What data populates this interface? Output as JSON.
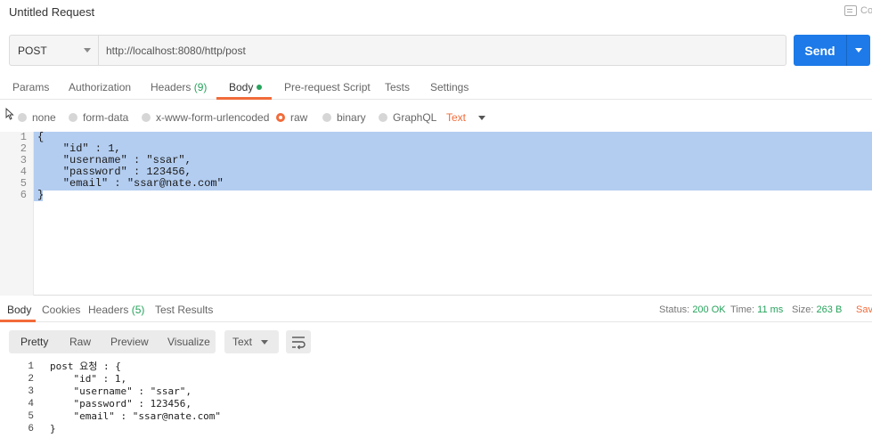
{
  "header": {
    "title": "Untitled Request",
    "comments_label": "Comments"
  },
  "request": {
    "method": "POST",
    "url": "http://localhost:8080/http/post",
    "send_label": "Send"
  },
  "request_tabs": {
    "params": "Params",
    "authorization": "Authorization",
    "headers": "Headers",
    "headers_count": "(9)",
    "body": "Body",
    "pre_request": "Pre-request Script",
    "tests": "Tests",
    "settings": "Settings"
  },
  "body_types": {
    "none": "none",
    "form_data": "form-data",
    "urlencoded": "x-www-form-urlencoded",
    "raw": "raw",
    "binary": "binary",
    "graphql": "GraphQL",
    "format": "Text",
    "selected": "raw"
  },
  "editor": {
    "line_numbers": "1\n2\n3\n4\n5\n6",
    "content": "{\n    \"id\" : 1,\n    \"username\" : \"ssar\",\n    \"password\" : 123456,\n    \"email\" : \"ssar@nate.com\"\n}"
  },
  "response_tabs": {
    "body": "Body",
    "cookies": "Cookies",
    "headers": "Headers",
    "headers_count": "(5)",
    "test_results": "Test Results"
  },
  "response_status": {
    "status_label": "Status:",
    "status_value": "200 OK",
    "time_label": "Time:",
    "time_value": "11 ms",
    "size_label": "Size:",
    "size_value": "263 B",
    "save_label": "Save Response"
  },
  "response_view": {
    "pretty": "Pretty",
    "raw": "Raw",
    "preview": "Preview",
    "visualize": "Visualize",
    "format": "Text"
  },
  "response_code": {
    "line_numbers": "1\n2\n3\n4\n5\n6",
    "content": "post 요청 : {\n    \"id\" : 1,\n    \"username\" : \"ssar\",\n    \"password\" : 123456,\n    \"email\" : \"ssar@nate.com\"\n}"
  },
  "colors": {
    "accent": "#f26b3a",
    "send": "#1d7ae8",
    "success": "#26a35c",
    "selection": "#b3cdf0"
  }
}
